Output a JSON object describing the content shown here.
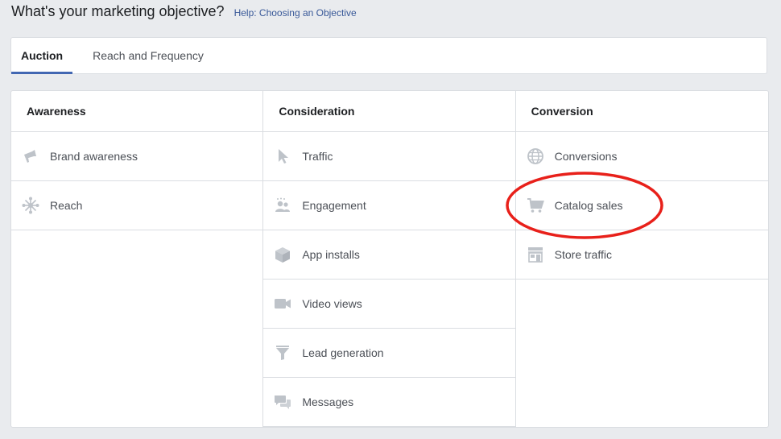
{
  "heading": {
    "title": "What's your marketing objective?",
    "help_link": "Help: Choosing an Objective"
  },
  "tabs": [
    {
      "label": "Auction",
      "active": true
    },
    {
      "label": "Reach and Frequency",
      "active": false
    }
  ],
  "columns": [
    {
      "header": "Awareness",
      "items": [
        {
          "label": "Brand awareness",
          "icon": "megaphone-icon"
        },
        {
          "label": "Reach",
          "icon": "reach-icon"
        }
      ]
    },
    {
      "header": "Consideration",
      "items": [
        {
          "label": "Traffic",
          "icon": "cursor-icon"
        },
        {
          "label": "Engagement",
          "icon": "people-icon"
        },
        {
          "label": "App installs",
          "icon": "box-icon"
        },
        {
          "label": "Video views",
          "icon": "video-camera-icon"
        },
        {
          "label": "Lead generation",
          "icon": "funnel-icon"
        },
        {
          "label": "Messages",
          "icon": "chat-bubbles-icon"
        }
      ]
    },
    {
      "header": "Conversion",
      "items": [
        {
          "label": "Conversions",
          "icon": "globe-icon"
        },
        {
          "label": "Catalog sales",
          "icon": "shopping-cart-icon"
        },
        {
          "label": "Store traffic",
          "icon": "storefront-icon"
        }
      ]
    }
  ],
  "annotation": {
    "highlighted_item": "Catalog sales",
    "color": "#e8201a"
  },
  "colors": {
    "accent": "#4267b2",
    "icon": "#bec3c9",
    "link": "#385898"
  }
}
